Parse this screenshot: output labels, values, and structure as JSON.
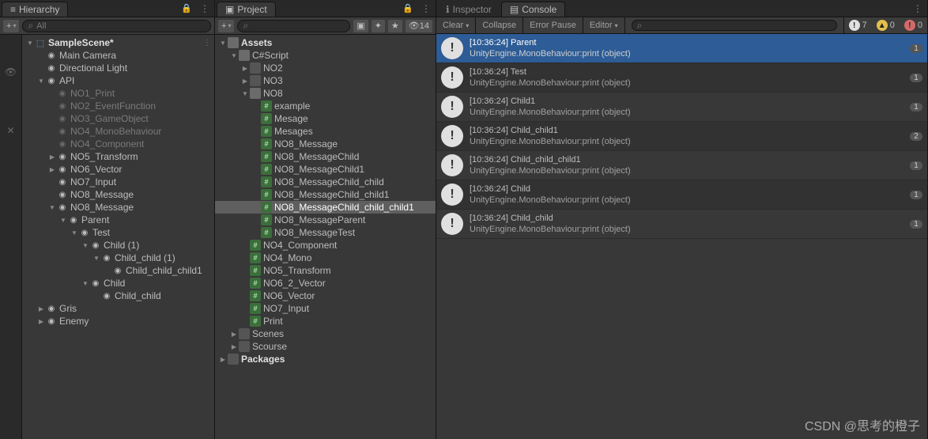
{
  "hierarchy": {
    "tab": "Hierarchy",
    "search_placeholder": "All",
    "scene": "SampleScene*",
    "scene_tail": "⋮",
    "nodes": [
      {
        "d": 1,
        "l": "Main Camera",
        "ico": "go"
      },
      {
        "d": 1,
        "l": "Directional Light",
        "ico": "go"
      },
      {
        "d": 1,
        "l": "API",
        "ico": "go",
        "arrow": "open"
      },
      {
        "d": 2,
        "l": "NO1_Print",
        "ico": "go-dim",
        "dim": true
      },
      {
        "d": 2,
        "l": "NO2_EventFunction",
        "ico": "go-dim",
        "dim": true
      },
      {
        "d": 2,
        "l": "NO3_GameObject",
        "ico": "go-dim",
        "dim": true
      },
      {
        "d": 2,
        "l": "NO4_MonoBehaviour",
        "ico": "go-dim",
        "dim": true
      },
      {
        "d": 2,
        "l": "NO4_Component",
        "ico": "go-dim",
        "dim": true
      },
      {
        "d": 2,
        "l": "NO5_Transform",
        "ico": "go",
        "arrow": "closed"
      },
      {
        "d": 2,
        "l": "NO6_Vector",
        "ico": "go",
        "arrow": "closed"
      },
      {
        "d": 2,
        "l": "NO7_Input",
        "ico": "go"
      },
      {
        "d": 2,
        "l": "NO8_Message",
        "ico": "go"
      },
      {
        "d": 2,
        "l": "NO8_Message",
        "ico": "go",
        "arrow": "open"
      },
      {
        "d": 3,
        "l": "Parent",
        "ico": "go",
        "arrow": "open"
      },
      {
        "d": 4,
        "l": "Test",
        "ico": "go",
        "arrow": "open"
      },
      {
        "d": 5,
        "l": "Child (1)",
        "ico": "go",
        "arrow": "open"
      },
      {
        "d": 6,
        "l": "Child_child (1)",
        "ico": "go",
        "arrow": "open"
      },
      {
        "d": 7,
        "l": "Child_child_child1",
        "ico": "go"
      },
      {
        "d": 5,
        "l": "Child",
        "ico": "go",
        "arrow": "open"
      },
      {
        "d": 6,
        "l": "Child_child",
        "ico": "go"
      },
      {
        "d": 1,
        "l": "Gris",
        "ico": "go",
        "arrow": "closed"
      },
      {
        "d": 1,
        "l": "Enemy",
        "ico": "go",
        "arrow": "closed"
      }
    ]
  },
  "project": {
    "tab": "Project",
    "vis": "14",
    "root": "Assets",
    "nodes": [
      {
        "d": 0,
        "l": "Assets",
        "ico": "folder open",
        "arrow": "open",
        "bold": true
      },
      {
        "d": 1,
        "l": "C#Script",
        "ico": "folder open",
        "arrow": "open"
      },
      {
        "d": 2,
        "l": "NO2",
        "ico": "folder",
        "arrow": "closed"
      },
      {
        "d": 2,
        "l": "NO3",
        "ico": "folder",
        "arrow": "closed"
      },
      {
        "d": 2,
        "l": "NO8",
        "ico": "folder open",
        "arrow": "open"
      },
      {
        "d": 3,
        "l": "example",
        "ico": "cs"
      },
      {
        "d": 3,
        "l": "Mesage",
        "ico": "cs"
      },
      {
        "d": 3,
        "l": "Mesages",
        "ico": "cs"
      },
      {
        "d": 3,
        "l": "NO8_Message",
        "ico": "cs"
      },
      {
        "d": 3,
        "l": "NO8_MessageChild",
        "ico": "cs"
      },
      {
        "d": 3,
        "l": "NO8_MessageChild1",
        "ico": "cs"
      },
      {
        "d": 3,
        "l": "NO8_MessageChild_child",
        "ico": "cs"
      },
      {
        "d": 3,
        "l": "NO8_MessageChild_child1",
        "ico": "cs"
      },
      {
        "d": 3,
        "l": "NO8_MessageChild_child_child1",
        "ico": "cs",
        "sel": true
      },
      {
        "d": 3,
        "l": "NO8_MessageParent",
        "ico": "cs"
      },
      {
        "d": 3,
        "l": "NO8_MessageTest",
        "ico": "cs"
      },
      {
        "d": 2,
        "l": "NO4_Component",
        "ico": "cs"
      },
      {
        "d": 2,
        "l": "NO4_Mono",
        "ico": "cs"
      },
      {
        "d": 2,
        "l": "NO5_Transform",
        "ico": "cs"
      },
      {
        "d": 2,
        "l": "NO6_2_Vector",
        "ico": "cs"
      },
      {
        "d": 2,
        "l": "NO6_Vector",
        "ico": "cs"
      },
      {
        "d": 2,
        "l": "NO7_Input",
        "ico": "cs"
      },
      {
        "d": 2,
        "l": "Print",
        "ico": "cs"
      },
      {
        "d": 1,
        "l": "Scenes",
        "ico": "folder",
        "arrow": "closed"
      },
      {
        "d": 1,
        "l": "Scourse",
        "ico": "folder",
        "arrow": "closed"
      },
      {
        "d": 0,
        "l": "Packages",
        "ico": "folder",
        "arrow": "closed",
        "bold": true
      }
    ]
  },
  "inspector_tab": "Inspector",
  "console": {
    "tab": "Console",
    "clear": "Clear",
    "collapse": "Collapse",
    "error_pause": "Error Pause",
    "editor": "Editor",
    "counts": {
      "info": "7",
      "warn": "0",
      "err": "0"
    },
    "entries": [
      {
        "t": "[10:36:24] Parent",
        "s": "UnityEngine.MonoBehaviour:print (object)",
        "c": "1",
        "sel": true
      },
      {
        "t": "[10:36:24] Test",
        "s": "UnityEngine.MonoBehaviour:print (object)",
        "c": "1"
      },
      {
        "t": "[10:36:24] Child1",
        "s": "UnityEngine.MonoBehaviour:print (object)",
        "c": "1"
      },
      {
        "t": "[10:36:24] Child_child1",
        "s": "UnityEngine.MonoBehaviour:print (object)",
        "c": "2"
      },
      {
        "t": "[10:36:24] Child_child_child1",
        "s": "UnityEngine.MonoBehaviour:print (object)",
        "c": "1"
      },
      {
        "t": "[10:36:24] Child",
        "s": "UnityEngine.MonoBehaviour:print (object)",
        "c": "1"
      },
      {
        "t": "[10:36:24] Child_child",
        "s": "UnityEngine.MonoBehaviour:print (object)",
        "c": "1"
      }
    ]
  },
  "watermark": "CSDN @思考的橙子"
}
